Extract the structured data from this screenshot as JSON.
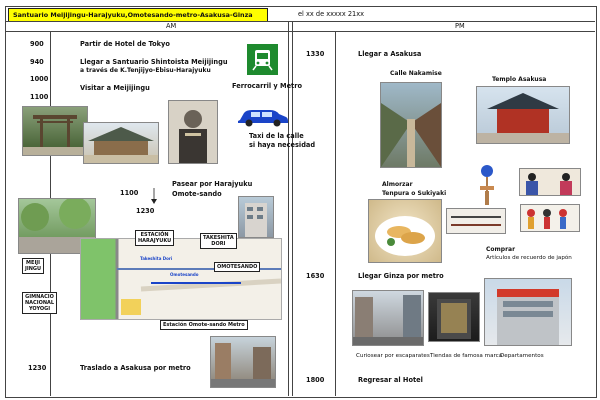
{
  "header": {
    "title": "Santuario Meijijingu-Harajyuku,Omotesando-metro-Asakusa-Ginza",
    "date": "el xx de xxxxx 21xx",
    "am": "AM",
    "pm": "PM"
  },
  "am": {
    "t900": "900",
    "e900": "Partir de Hotel de Tokyo",
    "t940": "940",
    "e940a": "Llegar a Santuario Shintoista Meijijingu",
    "e940b": "a través de K.Tenjijyo-Ebisu-Harajyuku",
    "t1000": "1000",
    "e1000": "Visitar a Meijijingu",
    "t1100": "1100",
    "train": "Ferrocarril y Metro",
    "taxi_a": "Taxi de la calle",
    "taxi_b": "si haya necesidad",
    "t1100b": "1100",
    "t1230": "1230",
    "walk_a": "Pasear por Harajyuku",
    "walk_b": "Omote-sando",
    "map": {
      "meiji": "MEIJI\nJINGU",
      "estacion": "ESTACIÓN\nHARAJYUKU",
      "takeshita": "TAKESHITA\nDORI",
      "omotesando": "OMOTESANDO",
      "gimnacio": "GIMNACIO\nNACIONAL\nYOYOGI",
      "metro": "Estación Omote-sando Metro",
      "road1": "Takeshita Dori",
      "road2": "Omotesando"
    },
    "t1230b": "1230",
    "e1230": "Traslado a Asakusa por metro"
  },
  "pm": {
    "t1330": "1330",
    "e1330": "Llegar a Asakusa",
    "calle": "Calle  Nakamise",
    "templo": "Templo  Asakusa",
    "almorzar": "Almorzar",
    "tempura": "Tenpura o Sukiyaki",
    "comprar": "Comprar",
    "articulos": "Artículos de recuerdo de japón",
    "t1630": "1630",
    "e1630": "Llegar Ginza por metro",
    "cap1": "Curiosear por escaparates",
    "cap2": "Tiendas de famosa marca",
    "cap3": "Departamentos",
    "t1800": "1800",
    "e1800": "Regresar al Hotel"
  },
  "colors": {
    "header_yellow": "#ffff00",
    "train_green": "#1e8a2e",
    "car_blue": "#1a44c8",
    "map_green": "#7fc36a"
  }
}
